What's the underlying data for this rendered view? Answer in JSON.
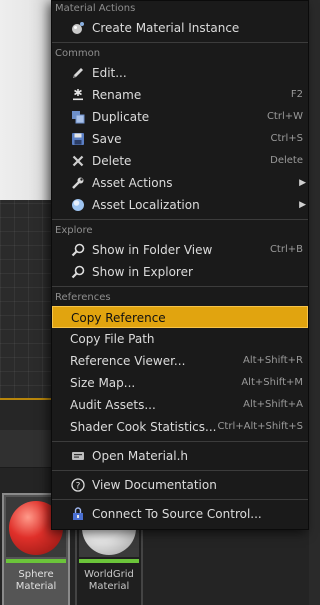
{
  "context_menu": {
    "sections": {
      "material_actions": "Material Actions",
      "common": "Common",
      "explore": "Explore",
      "references": "References"
    },
    "create_material_instance": "Create Material Instance",
    "edit": "Edit...",
    "rename": {
      "label": "Rename",
      "shortcut": "F2"
    },
    "duplicate": {
      "label": "Duplicate",
      "shortcut": "Ctrl+W"
    },
    "save": {
      "label": "Save",
      "shortcut": "Ctrl+S"
    },
    "delete": {
      "label": "Delete",
      "shortcut": "Delete"
    },
    "asset_actions": "Asset Actions",
    "asset_localization": "Asset Localization",
    "show_in_folder_view": {
      "label": "Show in Folder View",
      "shortcut": "Ctrl+B"
    },
    "show_in_explorer": "Show in Explorer",
    "copy_reference": "Copy Reference",
    "copy_file_path": "Copy File Path",
    "reference_viewer": {
      "label": "Reference Viewer...",
      "shortcut": "Alt+Shift+R"
    },
    "size_map": {
      "label": "Size Map...",
      "shortcut": "Alt+Shift+M"
    },
    "audit_assets": {
      "label": "Audit Assets...",
      "shortcut": "Alt+Shift+A"
    },
    "shader_cook_statistics": {
      "label": "Shader Cook Statistics...",
      "shortcut": "Ctrl+Alt+Shift+S"
    },
    "open_material_h": "Open Material.h",
    "view_documentation": "View Documentation",
    "connect_to_source_control": "Connect To Source Control..."
  },
  "content_browser": {
    "assets": [
      {
        "name_line1": "Sphere",
        "name_line2": "Material",
        "selected": true,
        "color": "#e0302a"
      },
      {
        "name_line1": "WorldGrid",
        "name_line2": "Material",
        "selected": false,
        "color": "#f2f2f2"
      }
    ]
  },
  "colors": {
    "highlight": "#e1a40f",
    "menu_bg": "#1a1a1a",
    "asset_type_strip": "#6bc43a"
  },
  "icons": {
    "submenu_arrow": "▶"
  }
}
